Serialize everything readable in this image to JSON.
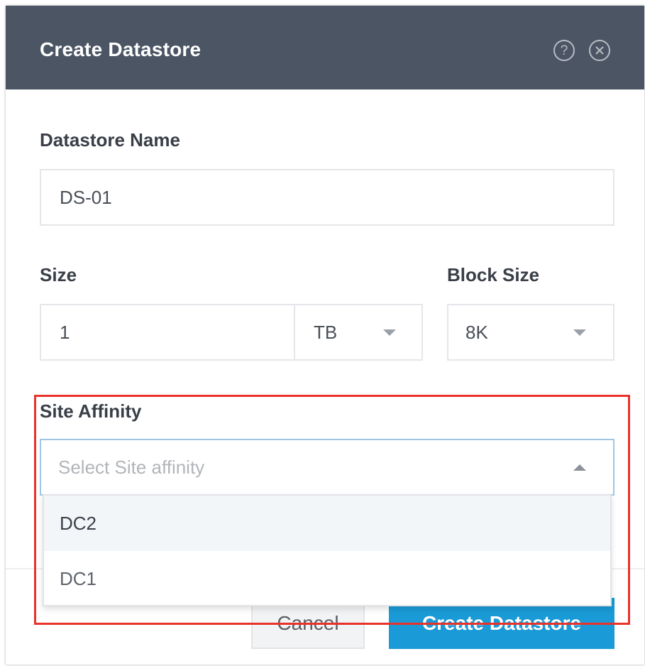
{
  "dialog": {
    "title": "Create Datastore",
    "help_icon": "question-circle-icon",
    "close_icon": "close-circle-icon"
  },
  "form": {
    "name_label": "Datastore Name",
    "name_value": "DS-01",
    "size_label": "Size",
    "size_value": "1",
    "size_unit": "TB",
    "block_size_label": "Block Size",
    "block_size_value": "8K",
    "site_affinity_label": "Site Affinity",
    "site_affinity_placeholder": "Select Site affinity",
    "site_affinity_options": [
      "DC2",
      "DC1"
    ],
    "site_affinity_highlighted": "DC2"
  },
  "footer": {
    "cancel_label": "Cancel",
    "create_label": "Create Datastore"
  },
  "colors": {
    "header_bg": "#4b5564",
    "primary_button": "#1a9ad6",
    "annotation_outline": "#e8322a"
  }
}
